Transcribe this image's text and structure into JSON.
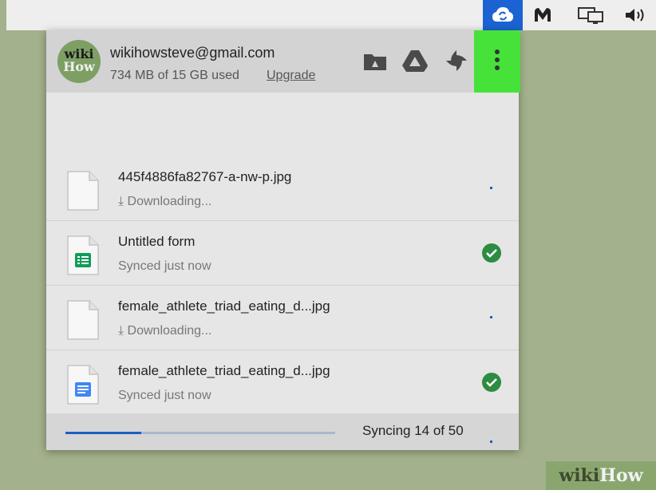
{
  "menubar": {
    "icons": [
      "google-drive-sync-icon",
      "malwarebytes-icon",
      "display-mirroring-icon",
      "volume-icon"
    ],
    "active_color": "#1b63d3"
  },
  "account": {
    "avatar_text_1": "wiki",
    "avatar_text_2": "How",
    "email": "wikihowsteve@gmail.com",
    "usage": "734 MB of 15 GB used",
    "upgrade_label": "Upgrade"
  },
  "header_actions": {
    "icons": [
      "folder-icon",
      "google-drive-icon",
      "photos-icon",
      "more-options-icon"
    ],
    "highlight_color": "#46e23a"
  },
  "files": [
    {
      "name": "445f4886fa82767-a-nw-p.jpg",
      "status": "Downloading...",
      "status_icon": "download-icon",
      "file_icon": "blank-file-icon",
      "state": "downloading"
    },
    {
      "name": "Untitled form",
      "status": "Synced just now",
      "status_icon": "",
      "file_icon": "google-sheets-icon",
      "state": "synced"
    },
    {
      "name": "female_athlete_triad_eating_d...jpg",
      "status": "Downloading...",
      "status_icon": "download-icon",
      "file_icon": "blank-file-icon",
      "state": "downloading"
    },
    {
      "name": "female_athlete_triad_eating_d...jpg",
      "status": "Synced just now",
      "status_icon": "",
      "file_icon": "google-docs-icon",
      "state": "synced"
    }
  ],
  "footer": {
    "progress": 0.28,
    "sync_text": "Syncing 14 of 50"
  },
  "colors": {
    "synced": "#2e8b42",
    "downloading": "#1c5fbf",
    "sheets": "#0f9d58",
    "docs": "#4285f4"
  },
  "watermark": {
    "part1": "wiki",
    "part2": "How"
  }
}
